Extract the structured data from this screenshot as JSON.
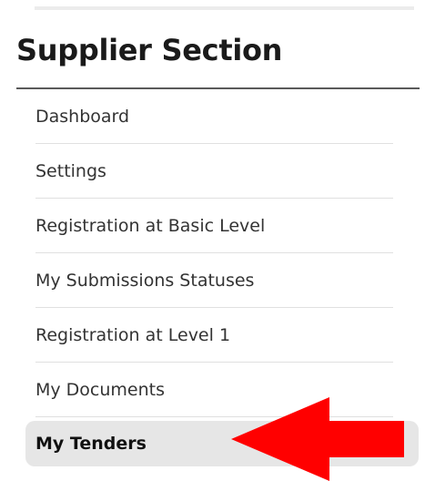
{
  "sidebar": {
    "title": "Supplier Section",
    "items": [
      {
        "label": "Dashboard"
      },
      {
        "label": "Settings"
      },
      {
        "label": "Registration at Basic Level"
      },
      {
        "label": "My Submissions Statuses"
      },
      {
        "label": "Registration at Level 1"
      },
      {
        "label": "My Documents"
      },
      {
        "label": "My Tenders",
        "active": true
      }
    ]
  },
  "annotation": {
    "arrow_color": "#ff0000",
    "arrow_direction": "left",
    "arrow_target": "My Tenders"
  }
}
